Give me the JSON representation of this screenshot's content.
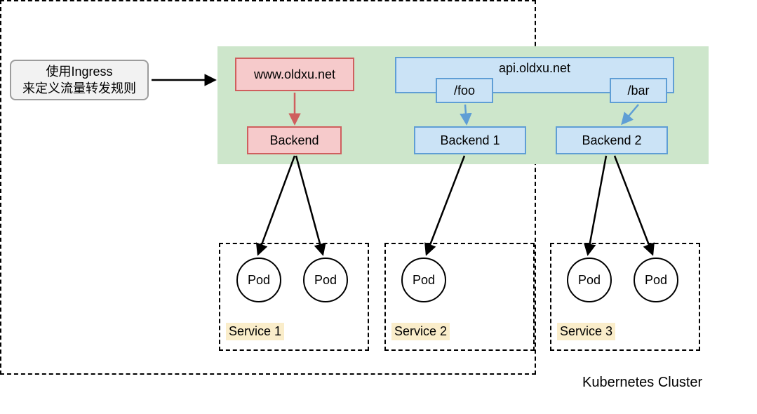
{
  "external_label_line1": "使用Ingress",
  "external_label_line2": "来定义流量转发规则",
  "cluster_label": "Kubernetes Cluster",
  "ingress": {
    "host1": "www.oldxu.net",
    "backend1": "Backend",
    "host2": "api.oldxu.net",
    "path_foo": "/foo",
    "path_bar": "/bar",
    "backend2": "Backend 1",
    "backend3": "Backend 2"
  },
  "services": {
    "s1": {
      "label": "Service 1",
      "pods": [
        "Pod",
        "Pod"
      ]
    },
    "s2": {
      "label": "Service 2",
      "pods": [
        "Pod"
      ]
    },
    "s3": {
      "label": "Service 3",
      "pods": [
        "Pod",
        "Pod"
      ]
    }
  }
}
